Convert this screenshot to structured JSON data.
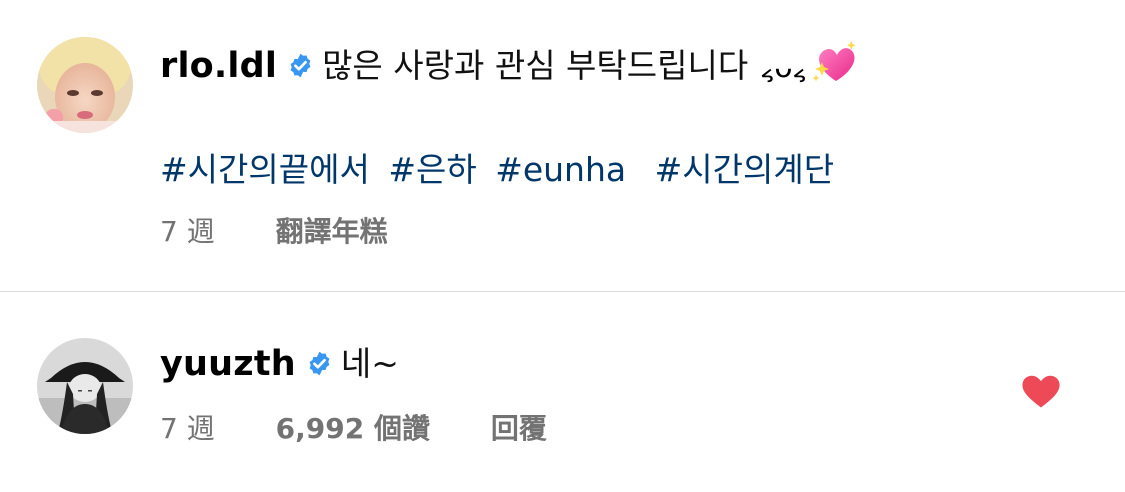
{
  "comments": [
    {
      "username": "rlo.ldl",
      "verified": true,
      "text": "많은 사랑과 관심 부탁드립니다",
      "emoticon": "៹ᴗ៹",
      "emoji_icon": "sparkling-heart-icon",
      "hashtags": [
        "#시간의끝에서",
        "#은하",
        "#eunha",
        "#시간의계단"
      ],
      "time": "7 週",
      "action": "翻譯年糕"
    },
    {
      "username": "yuuzth",
      "verified": true,
      "text": "네~",
      "time": "7 週",
      "likes": "6,992 個讚",
      "reply": "回覆",
      "liked": true
    }
  ],
  "colors": {
    "hashtag": "#00376b",
    "verified": "#3897f0",
    "meta": "#737373",
    "liked_heart": "#ed4956",
    "divider": "#dbdbdb"
  }
}
